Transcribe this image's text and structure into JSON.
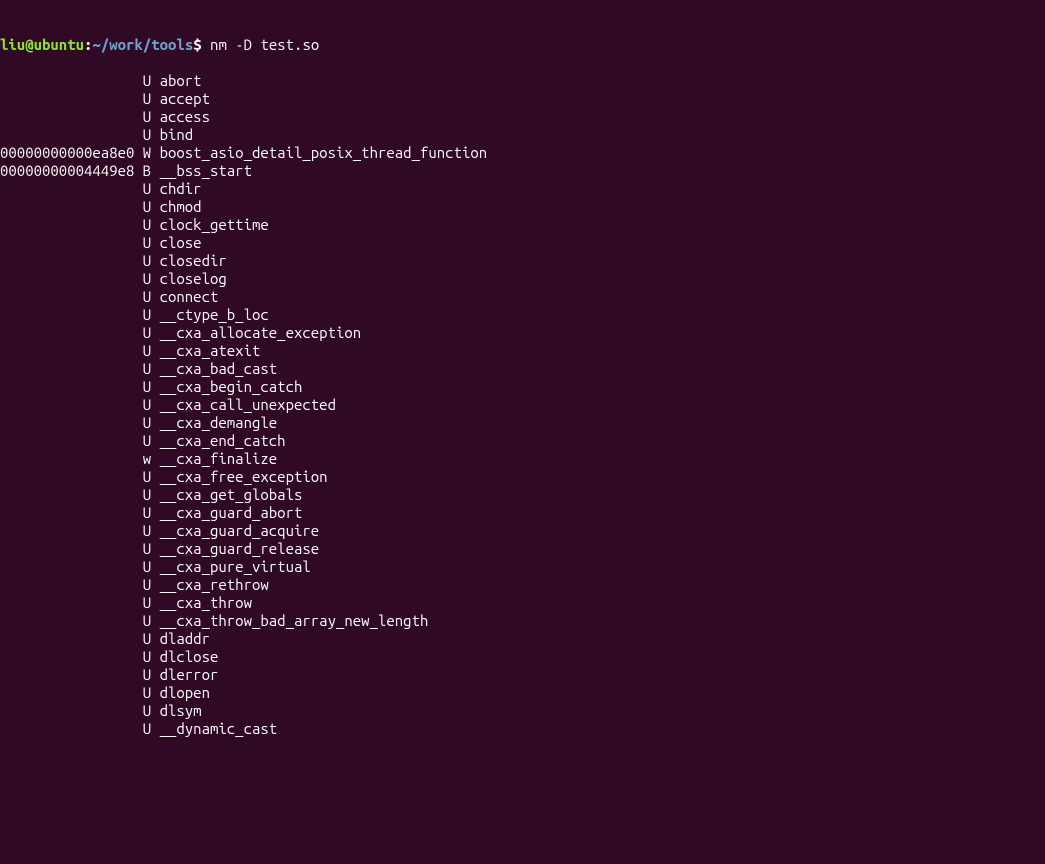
{
  "prompt": {
    "user": "liu@ubuntu",
    "path": "~/work/tools",
    "command": "nm -D test.so"
  },
  "nm": {
    "rows": [
      {
        "addr": "",
        "type": "U",
        "symbol": "abort"
      },
      {
        "addr": "",
        "type": "U",
        "symbol": "accept"
      },
      {
        "addr": "",
        "type": "U",
        "symbol": "access"
      },
      {
        "addr": "",
        "type": "U",
        "symbol": "bind"
      },
      {
        "addr": "00000000000ea8e0",
        "type": "W",
        "symbol": "boost_asio_detail_posix_thread_function"
      },
      {
        "addr": "00000000004449e8",
        "type": "B",
        "symbol": "__bss_start"
      },
      {
        "addr": "",
        "type": "U",
        "symbol": "chdir"
      },
      {
        "addr": "",
        "type": "U",
        "symbol": "chmod"
      },
      {
        "addr": "",
        "type": "U",
        "symbol": "clock_gettime"
      },
      {
        "addr": "",
        "type": "U",
        "symbol": "close"
      },
      {
        "addr": "",
        "type": "U",
        "symbol": "closedir"
      },
      {
        "addr": "",
        "type": "U",
        "symbol": "closelog"
      },
      {
        "addr": "",
        "type": "U",
        "symbol": "connect"
      },
      {
        "addr": "",
        "type": "U",
        "symbol": "__ctype_b_loc"
      },
      {
        "addr": "",
        "type": "U",
        "symbol": "__cxa_allocate_exception"
      },
      {
        "addr": "",
        "type": "U",
        "symbol": "__cxa_atexit"
      },
      {
        "addr": "",
        "type": "U",
        "symbol": "__cxa_bad_cast"
      },
      {
        "addr": "",
        "type": "U",
        "symbol": "__cxa_begin_catch"
      },
      {
        "addr": "",
        "type": "U",
        "symbol": "__cxa_call_unexpected"
      },
      {
        "addr": "",
        "type": "U",
        "symbol": "__cxa_demangle"
      },
      {
        "addr": "",
        "type": "U",
        "symbol": "__cxa_end_catch"
      },
      {
        "addr": "",
        "type": "w",
        "symbol": "__cxa_finalize"
      },
      {
        "addr": "",
        "type": "U",
        "symbol": "__cxa_free_exception"
      },
      {
        "addr": "",
        "type": "U",
        "symbol": "__cxa_get_globals"
      },
      {
        "addr": "",
        "type": "U",
        "symbol": "__cxa_guard_abort"
      },
      {
        "addr": "",
        "type": "U",
        "symbol": "__cxa_guard_acquire"
      },
      {
        "addr": "",
        "type": "U",
        "symbol": "__cxa_guard_release"
      },
      {
        "addr": "",
        "type": "U",
        "symbol": "__cxa_pure_virtual"
      },
      {
        "addr": "",
        "type": "U",
        "symbol": "__cxa_rethrow"
      },
      {
        "addr": "",
        "type": "U",
        "symbol": "__cxa_throw"
      },
      {
        "addr": "",
        "type": "U",
        "symbol": "__cxa_throw_bad_array_new_length"
      },
      {
        "addr": "",
        "type": "U",
        "symbol": "dladdr"
      },
      {
        "addr": "",
        "type": "U",
        "symbol": "dlclose"
      },
      {
        "addr": "",
        "type": "U",
        "symbol": "dlerror"
      },
      {
        "addr": "",
        "type": "U",
        "symbol": "dlopen"
      },
      {
        "addr": "",
        "type": "U",
        "symbol": "dlsym"
      },
      {
        "addr": "",
        "type": "U",
        "symbol": "__dynamic_cast"
      }
    ]
  }
}
